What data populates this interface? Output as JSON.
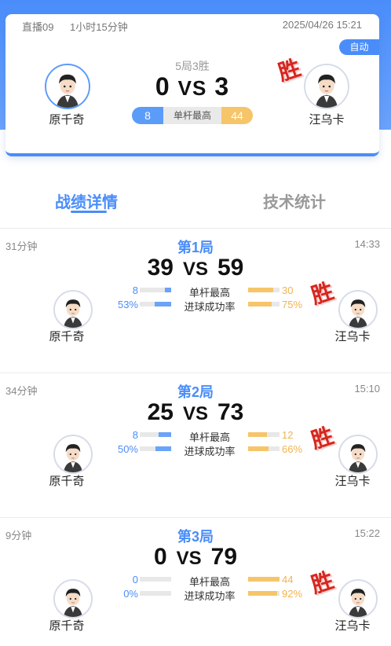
{
  "match": {
    "live_label": "直播09",
    "duration": "1小时15分钟",
    "datetime": "2025/04/26 15:21",
    "auto_badge": "自动",
    "format": "5局3胜",
    "score_left": "0",
    "vs": "VS",
    "score_right": "3",
    "high_break_left": "8",
    "high_break_label": "单杆最高",
    "high_break_right": "44",
    "player_left": "原千奇",
    "player_right": "汪乌卡",
    "win_mark": "胜"
  },
  "tabs": {
    "details": "战绩详情",
    "stats": "技术统计"
  },
  "stat_labels": {
    "high_break": "单杆最高",
    "pot_success": "进球成功率"
  },
  "rounds": [
    {
      "title": "第1局",
      "duration": "31分钟",
      "time": "14:33",
      "score_left": "39",
      "vs": "VS",
      "score_right": "59",
      "high_break_left": "8",
      "high_break_right": "30",
      "pot_left": "53%",
      "pot_right": "75%",
      "high_break_left_fill": 0.21,
      "high_break_right_fill": 0.79,
      "pot_left_fill": 0.53,
      "pot_right_fill": 0.75,
      "player_left": "原千奇",
      "player_right": "汪乌卡",
      "win_mark": "胜"
    },
    {
      "title": "第2局",
      "duration": "34分钟",
      "time": "15:10",
      "score_left": "25",
      "vs": "VS",
      "score_right": "73",
      "high_break_left": "8",
      "high_break_right": "12",
      "pot_left": "50%",
      "pot_right": "66%",
      "high_break_left_fill": 0.4,
      "high_break_right_fill": 0.6,
      "pot_left_fill": 0.5,
      "pot_right_fill": 0.66,
      "player_left": "原千奇",
      "player_right": "汪乌卡",
      "win_mark": "胜"
    },
    {
      "title": "第3局",
      "duration": "9分钟",
      "time": "15:22",
      "score_left": "0",
      "vs": "VS",
      "score_right": "79",
      "high_break_left": "0",
      "high_break_right": "44",
      "pot_left": "0%",
      "pot_right": "92%",
      "high_break_left_fill": 0,
      "high_break_right_fill": 1,
      "pot_left_fill": 0,
      "pot_right_fill": 0.92,
      "player_left": "原千奇",
      "player_right": "汪乌卡",
      "win_mark": "胜"
    }
  ],
  "colors": {
    "accent_blue": "#4a8dfa",
    "accent_orange": "#f6c56a",
    "win_red": "#d7261e"
  }
}
